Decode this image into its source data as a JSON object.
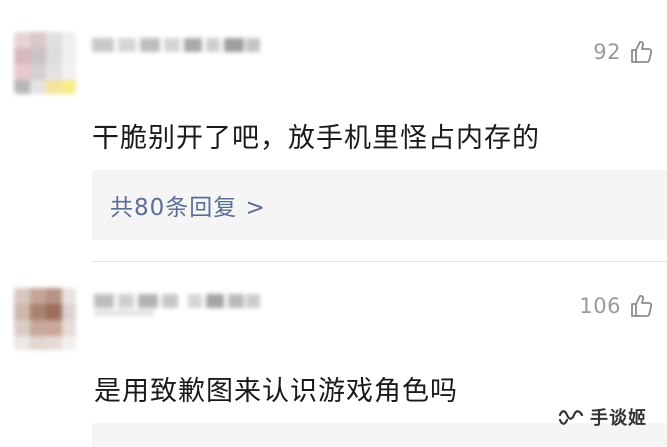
{
  "comments": [
    {
      "likes": "92",
      "text": "干脆别开了吧，放手机里怪占内存的",
      "replies_label": "共80条回复 >"
    },
    {
      "likes": "106",
      "text": "是用致歉图来认识游戏角色吗"
    }
  ],
  "icons": {
    "like": "thumbs-up-outline-icon",
    "watermark": "wechat-channel-icon"
  },
  "colors": {
    "like_count": "#9a9a9a",
    "reply_link": "#5b6f96",
    "reply_bg": "#f5f5f5",
    "text": "#1a1a1a"
  },
  "watermark": {
    "text": "手谈姬"
  }
}
